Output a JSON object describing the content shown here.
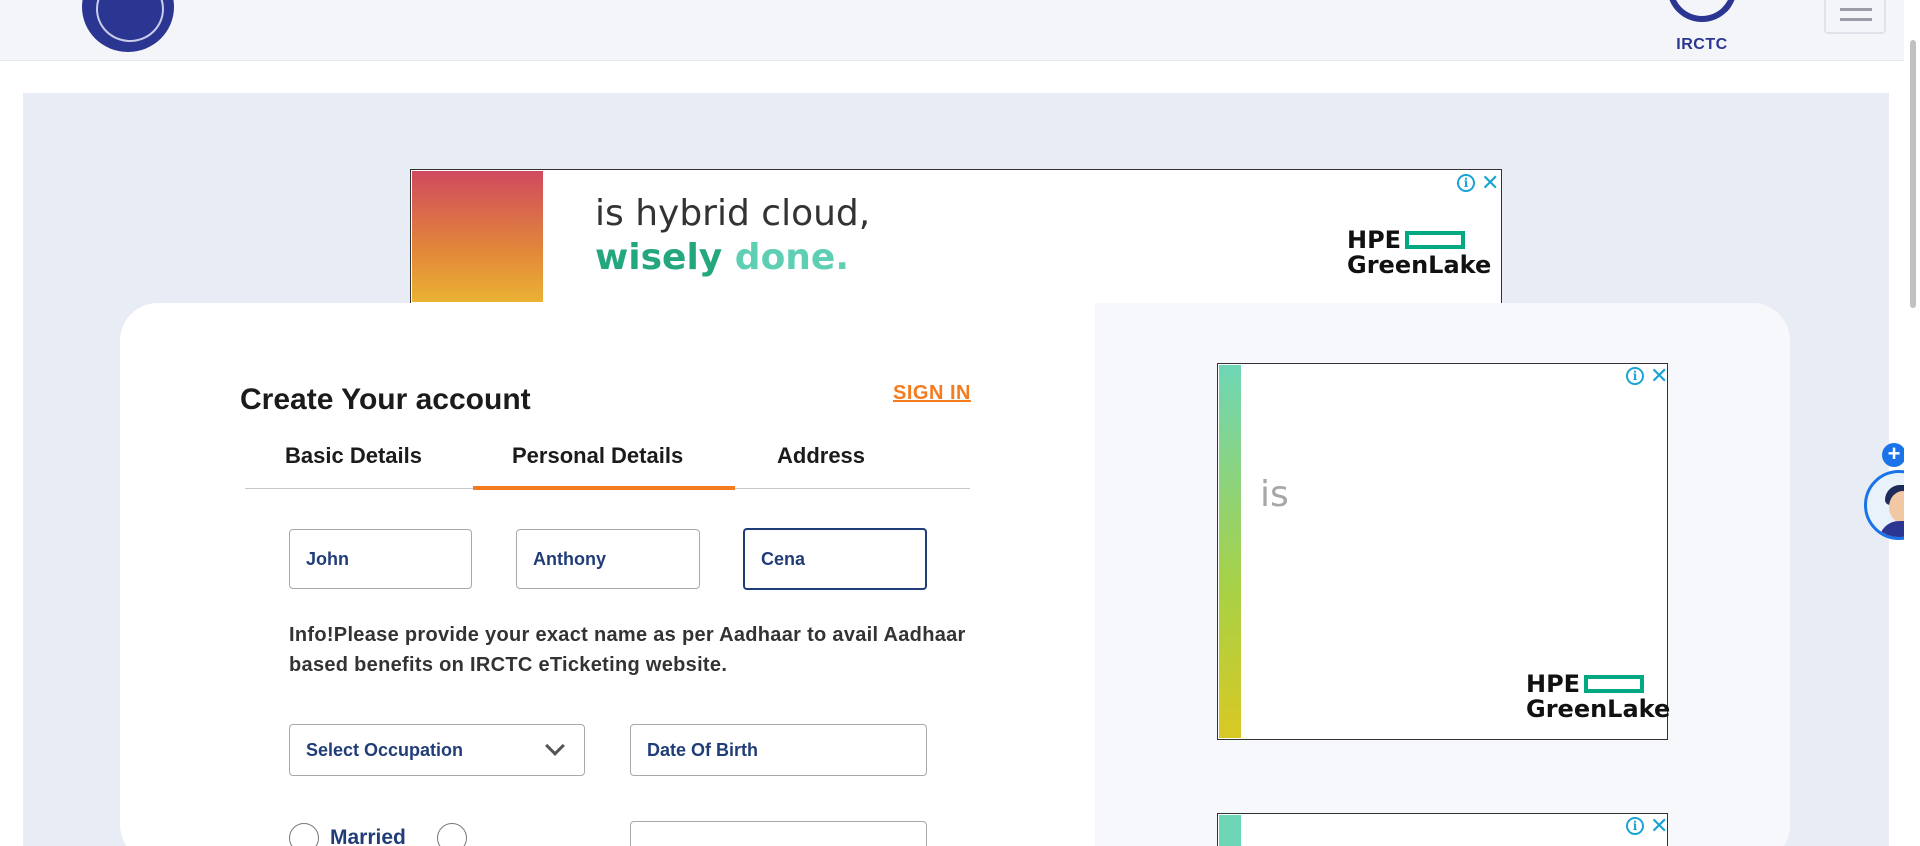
{
  "header": {
    "left_logo": "indian-railways-logo",
    "right_logo_text": "IRCTC",
    "menu_icon": "hamburger-menu-icon"
  },
  "ads": {
    "banner": {
      "line1": "is hybrid cloud,",
      "line2_a": "wisely",
      "line2_b": "done.",
      "brand_line1": "HPE",
      "brand_line2": "GreenLake"
    },
    "side": {
      "text": "is",
      "brand_line1": "HPE",
      "brand_line2": "GreenLake"
    }
  },
  "form": {
    "title": "Create Your account",
    "sign_in": "SIGN IN",
    "tabs": [
      {
        "label": "Basic Details"
      },
      {
        "label": "Personal Details"
      },
      {
        "label": "Address"
      }
    ],
    "active_tab": "Personal Details",
    "first_name": "John",
    "middle_name": "Anthony",
    "last_name": "Cena",
    "info": "Info!Please provide your exact name as per Aadhaar to avail Aadhaar based benefits on IRCTC eTicketing website.",
    "occupation": "Select Occupation",
    "dob": "Date Of Birth",
    "marital_married": "Married"
  },
  "colors": {
    "accent": "#f47b20",
    "brand": "#213d77",
    "panel_bg": "#e8edf5"
  }
}
